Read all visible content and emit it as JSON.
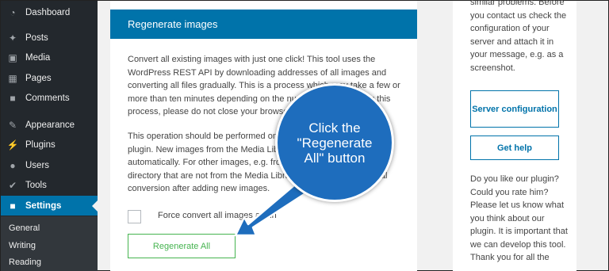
{
  "sidebar": {
    "items": [
      {
        "label": "Dashboard",
        "icon": "dashboard-icon"
      },
      {
        "label": "Posts",
        "icon": "pin-icon"
      },
      {
        "label": "Media",
        "icon": "media-icon"
      },
      {
        "label": "Pages",
        "icon": "pages-icon"
      },
      {
        "label": "Comments",
        "icon": "comment-icon"
      },
      {
        "label": "Appearance",
        "icon": "brush-icon"
      },
      {
        "label": "Plugins",
        "icon": "plug-icon"
      },
      {
        "label": "Users",
        "icon": "user-icon"
      },
      {
        "label": "Tools",
        "icon": "wrench-icon"
      },
      {
        "label": "Settings",
        "icon": "settings-icon"
      }
    ],
    "submenu": [
      {
        "label": "General"
      },
      {
        "label": "Writing"
      },
      {
        "label": "Reading"
      }
    ]
  },
  "panel": {
    "title": "Regenerate images",
    "para1": "Convert all existing images with just one click! This tool uses the WordPress REST API by downloading addresses of all images and converting all files gradually. This is a process which may take a few or more than ten minutes depending on the number of files. During this process, please do not close your browser window.",
    "para2": "This operation should be performed only once after installing the plugin. New images from the Media Library will be converted automatically. For other images, e.g. from the /themes or /uploads directory that are not from the Media Library, you must start manual conversion after adding new images.",
    "checkbox_label": "Force convert all images again",
    "button_label": "Regenerate All"
  },
  "right": {
    "text_top": "similar problems. Before you contact us check the configuration of your server and attach it in your message, e.g. as a screenshot.",
    "server_button": "Server configuration",
    "help_button": "Get help",
    "text_bottom": "Do you like our plugin? Could you rate him? Please let us know what you think about our plugin. It is important that we can develop this tool. Thank you for all the"
  },
  "callout": {
    "text": "Click the\n\"Regenerate\nAll\" button"
  },
  "colors": {
    "sidebar_bg": "#23282d",
    "accent": "#0073aa",
    "green": "#46b450",
    "callout": "#1e6dbd"
  }
}
